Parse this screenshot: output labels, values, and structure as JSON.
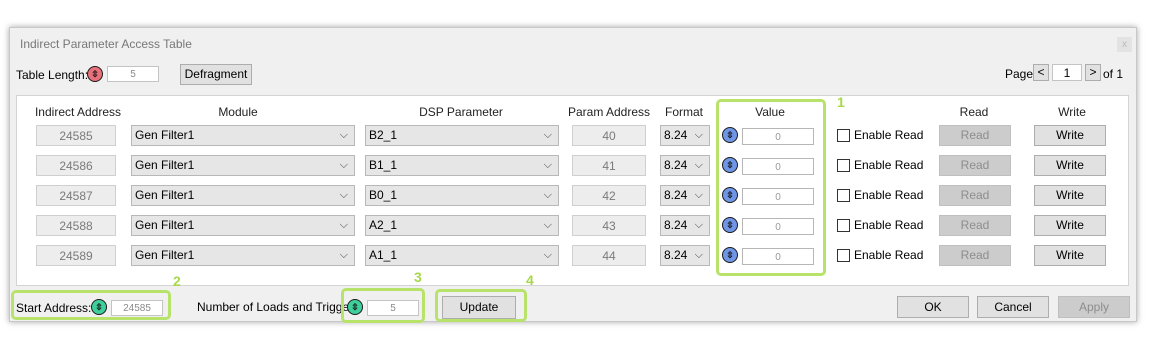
{
  "window": {
    "title": "Indirect Parameter Access Table",
    "close_glyph": "x"
  },
  "toolbar": {
    "table_length_label": "Table Length:",
    "table_length_value": "5",
    "defragment_label": "Defragment",
    "page_label": "Page",
    "page_value": "1",
    "page_of": "of 1",
    "prev_glyph": "<",
    "next_glyph": ">"
  },
  "table": {
    "headers": {
      "indirect_address": "Indirect Address",
      "module": "Module",
      "dsp_parameter": "DSP Parameter",
      "param_address": "Param Address",
      "format": "Format",
      "value": "Value",
      "read": "Read",
      "write": "Write"
    },
    "rows": [
      {
        "indirect_address": "24585",
        "module": "Gen Filter1",
        "dsp_parameter": "B2_1",
        "param_address": "40",
        "format": "8.24",
        "value": "0",
        "enable_read": "Enable Read",
        "read": "Read",
        "write": "Write"
      },
      {
        "indirect_address": "24586",
        "module": "Gen Filter1",
        "dsp_parameter": "B1_1",
        "param_address": "41",
        "format": "8.24",
        "value": "0",
        "enable_read": "Enable Read",
        "read": "Read",
        "write": "Write"
      },
      {
        "indirect_address": "24587",
        "module": "Gen Filter1",
        "dsp_parameter": "B0_1",
        "param_address": "42",
        "format": "8.24",
        "value": "0",
        "enable_read": "Enable Read",
        "read": "Read",
        "write": "Write"
      },
      {
        "indirect_address": "24588",
        "module": "Gen Filter1",
        "dsp_parameter": "A2_1",
        "param_address": "43",
        "format": "8.24",
        "value": "0",
        "enable_read": "Enable Read",
        "read": "Read",
        "write": "Write"
      },
      {
        "indirect_address": "24589",
        "module": "Gen Filter1",
        "dsp_parameter": "A1_1",
        "param_address": "44",
        "format": "8.24",
        "value": "0",
        "enable_read": "Enable Read",
        "read": "Read",
        "write": "Write"
      }
    ]
  },
  "footer": {
    "start_address_label": "Start Address:",
    "start_address_value": "24585",
    "loads_label": "Number of Loads and Trigge",
    "loads_value": "5",
    "update_label": "Update",
    "ok_label": "OK",
    "cancel_label": "Cancel",
    "apply_label": "Apply"
  },
  "icons": {
    "spinner_glyph": "⇳"
  },
  "annotations": {
    "callout_1": "1",
    "callout_2": "2",
    "callout_3": "3",
    "callout_4": "4",
    "highlight_color": "#b8e36a"
  },
  "colors": {
    "icon_red": "#e8707a",
    "icon_blue": "#6f96e6",
    "icon_green": "#3fcf9b"
  }
}
